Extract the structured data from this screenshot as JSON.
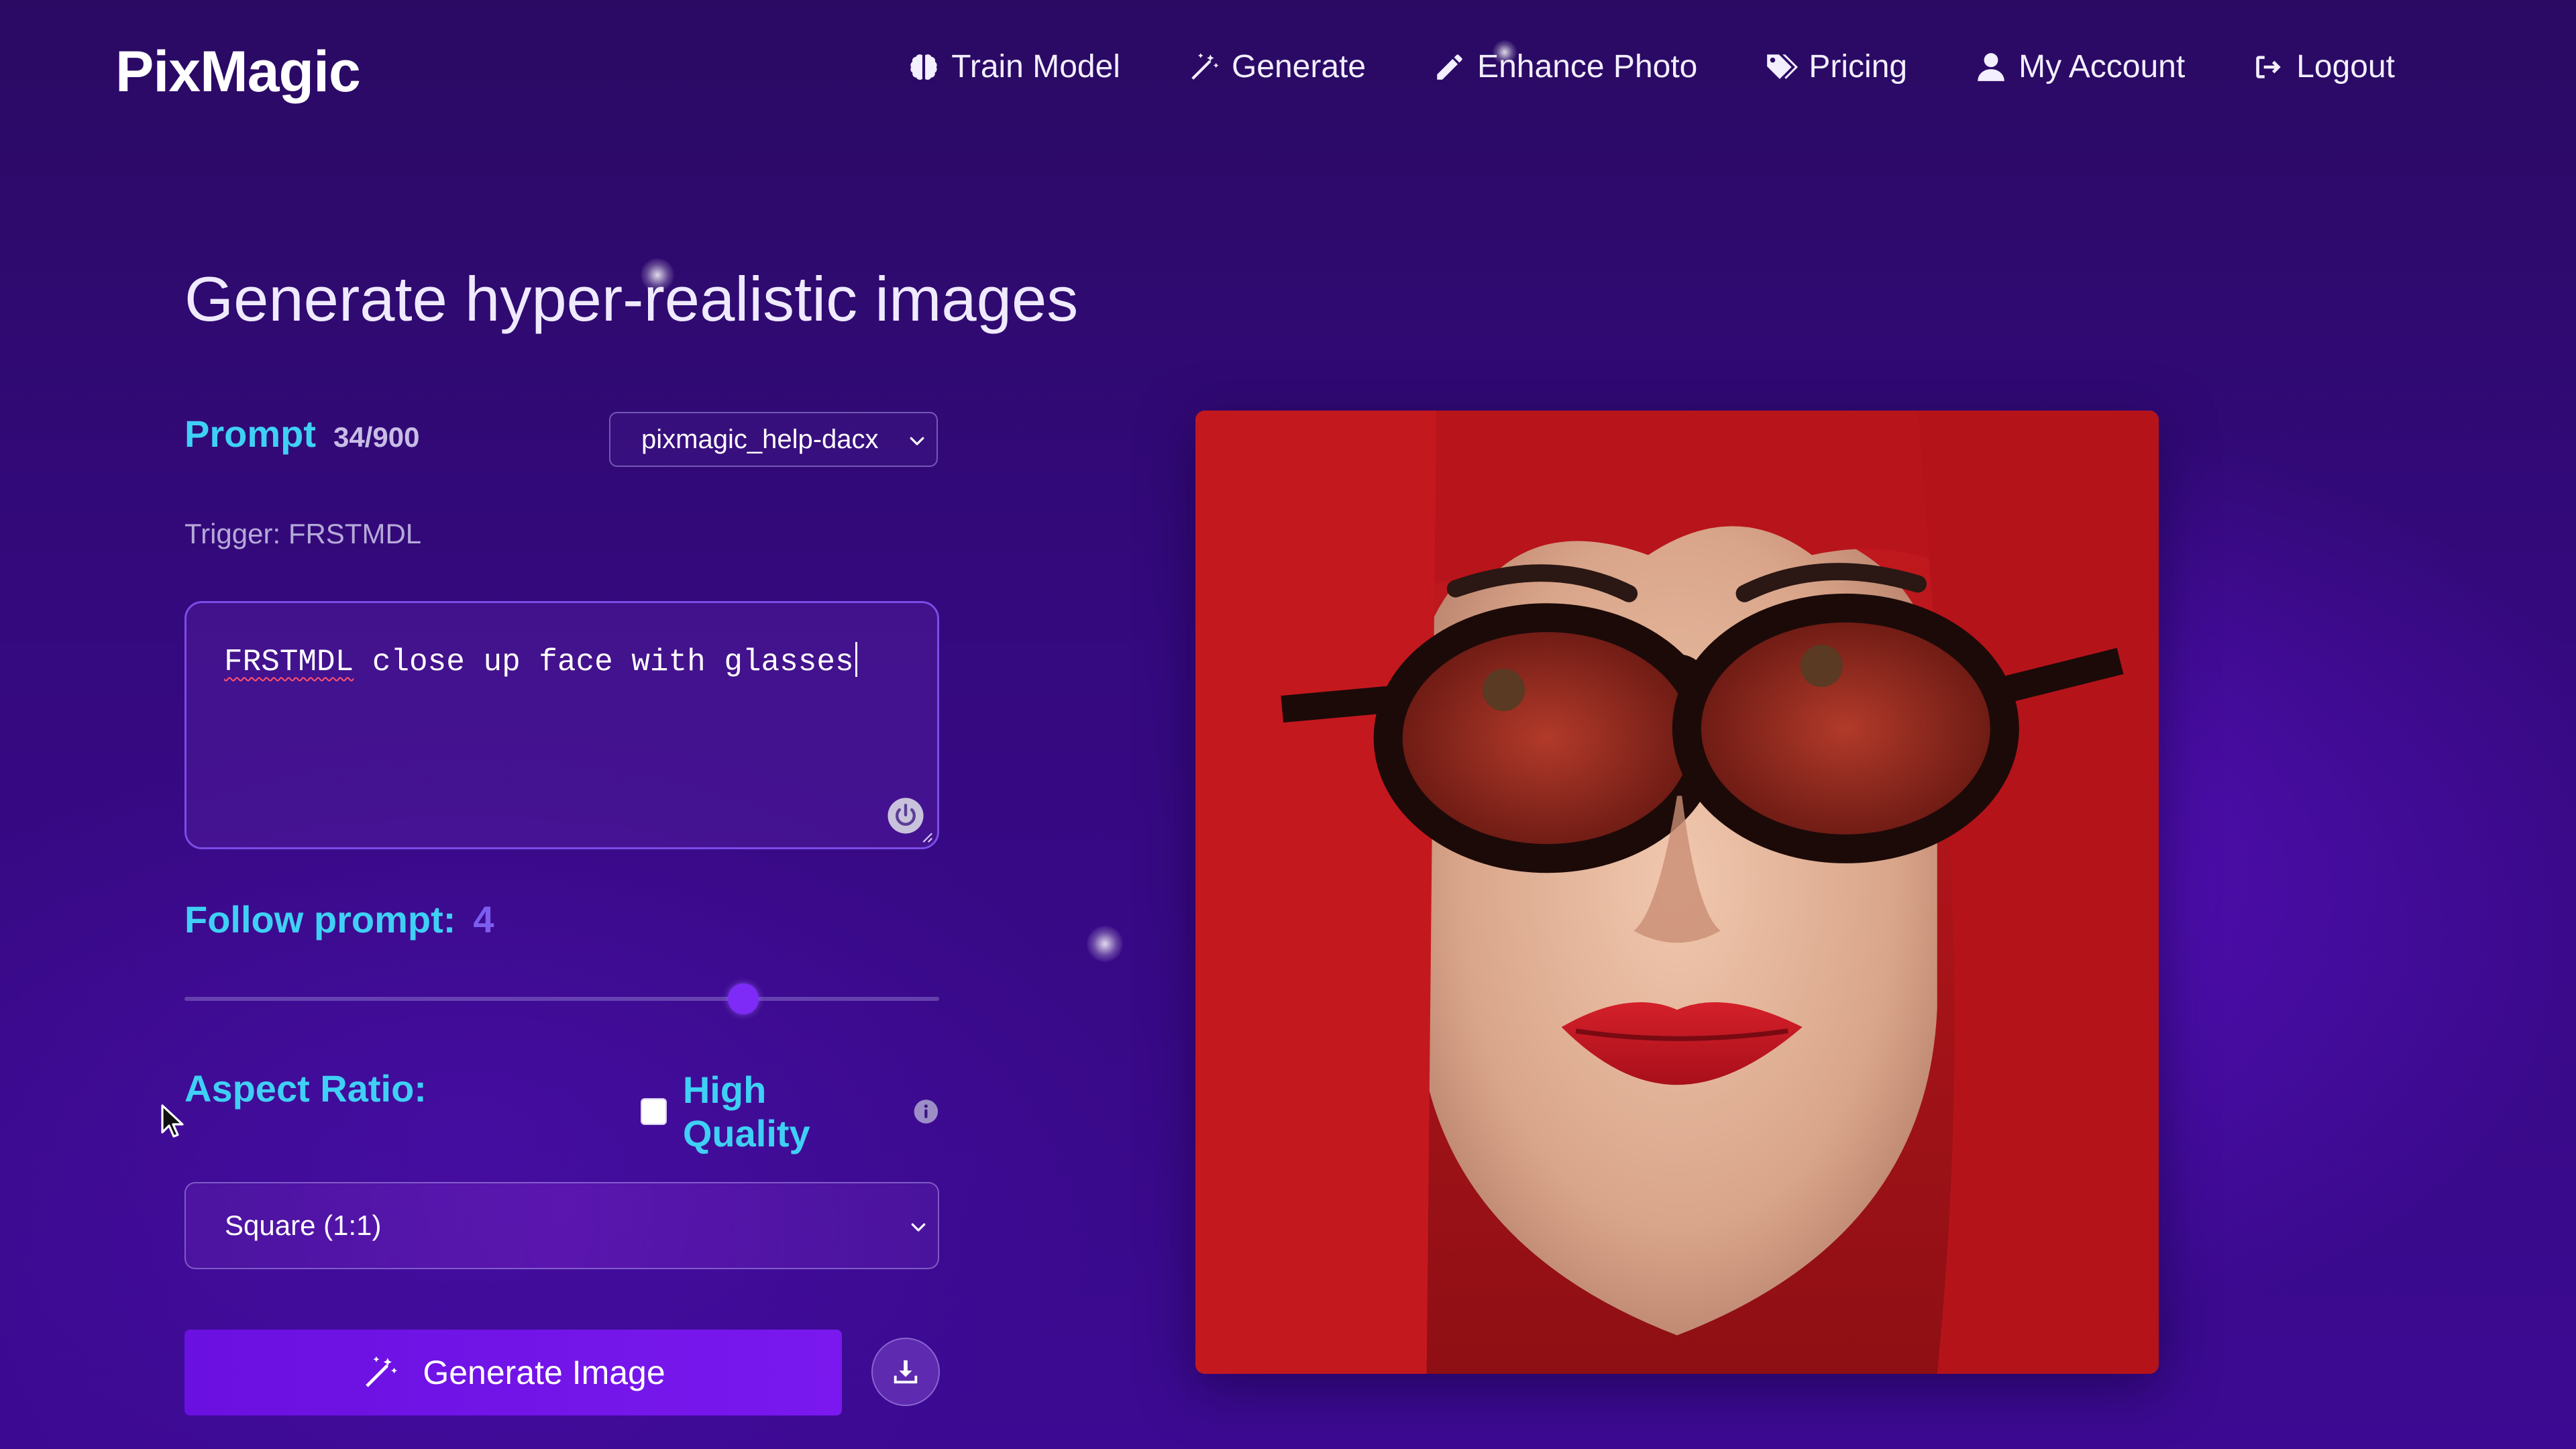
{
  "brand": "PixMagic",
  "nav": {
    "items": [
      {
        "label": "Train Model",
        "icon": "brain-icon"
      },
      {
        "label": "Generate",
        "icon": "magic-wand-icon"
      },
      {
        "label": "Enhance Photo",
        "icon": "pencil-icon"
      },
      {
        "label": "Pricing",
        "icon": "tags-icon"
      },
      {
        "label": "My Account",
        "icon": "user-icon"
      },
      {
        "label": "Logout",
        "icon": "logout-icon"
      }
    ]
  },
  "main": {
    "title": "Generate hyper-realistic images"
  },
  "prompt": {
    "label": "Prompt",
    "count": "34/900",
    "model_select": "pixmagic_help-dacx",
    "trigger": "Trigger: FRSTMDL",
    "trigger_word": "FRSTMDL",
    "text_rest": " close up face with glasses"
  },
  "follow_prompt": {
    "label": "Follow prompt:",
    "value": "4",
    "slider_fraction": 0.74
  },
  "aspect_ratio": {
    "label": "Aspect Ratio:",
    "selected": "Square (1:1)"
  },
  "high_quality": {
    "label": "High Quality",
    "checked": false
  },
  "actions": {
    "generate_label": "Generate Image"
  },
  "colors": {
    "accent_cyan": "#3fd0f5",
    "accent_purple": "#7e2bf7",
    "button_purple": "#6a10e0",
    "background": "#2f0a72"
  }
}
